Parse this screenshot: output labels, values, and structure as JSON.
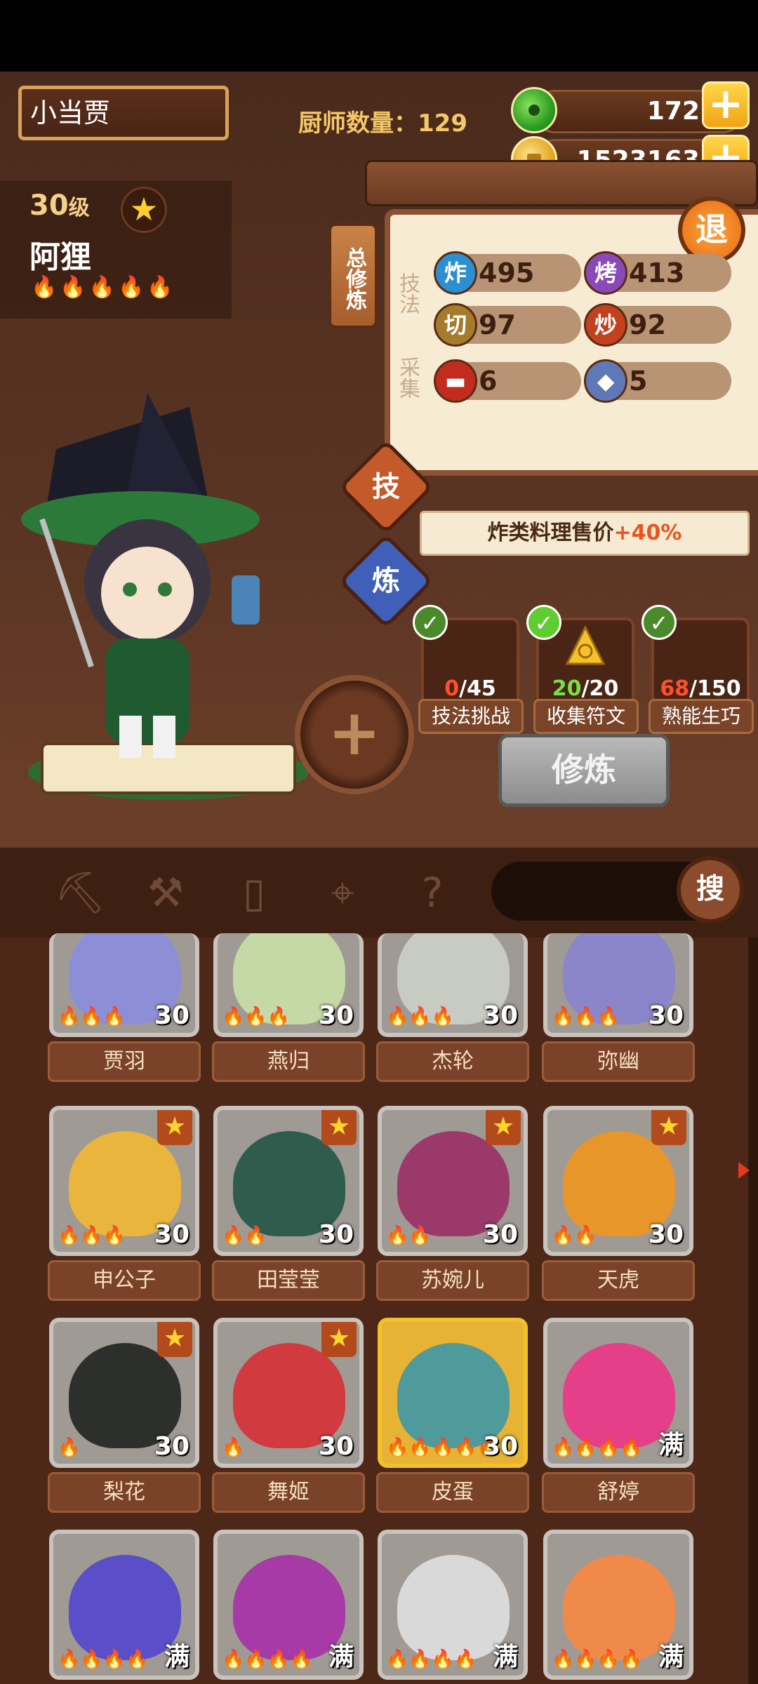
{
  "header": {
    "player_name": "小当贾",
    "chef_count_label": "厨师数量：129",
    "jade_amount": "172",
    "coin_amount": "1523163"
  },
  "chef": {
    "level_number": "30",
    "level_suffix": "级",
    "name": "阿狸",
    "flames": "🔥🔥🔥🔥🔥"
  },
  "panel": {
    "tag_label": "总修炼",
    "skill_label": "技法",
    "gather_label": "采集",
    "exit_label": "退",
    "skills": [
      {
        "icon": "炸",
        "value": "495",
        "color": "#2b8fd1"
      },
      {
        "icon": "烤",
        "value": "413",
        "color": "#8a49b8"
      },
      {
        "icon": "切",
        "value": "97",
        "color": "#a57b2c"
      },
      {
        "icon": "炒",
        "value": "92",
        "color": "#c2421f"
      }
    ],
    "gather": [
      {
        "icon": "meat-icon",
        "value": "6",
        "color": "#c22c1f"
      },
      {
        "icon": "fish-icon",
        "value": "5",
        "color": "#5f79b8"
      }
    ],
    "tab_skill": "技",
    "tab_train": "炼",
    "bonus_prefix": "炸类料理售价",
    "bonus_value": "+40%",
    "tasks": [
      {
        "current": "0",
        "total": "/45",
        "label": "技法挑战",
        "current_color": "#ff4f2e"
      },
      {
        "current": "20",
        "total": "/20",
        "label": "收集符文",
        "current_color": "#77e04a"
      },
      {
        "current": "68",
        "total": "/150",
        "label": "熟能生巧",
        "current_color": "#ff4f2e"
      }
    ],
    "train_button": "修炼",
    "search_button": "搜"
  },
  "chefs": [
    {
      "name": "贾羽",
      "level": "30",
      "fires": "🔥🔥🔥",
      "star": false,
      "color": "#8d8fd6",
      "gold": false
    },
    {
      "name": "燕归",
      "level": "30",
      "fires": "🔥🔥🔥",
      "star": false,
      "color": "#c4d9a5",
      "gold": false
    },
    {
      "name": "杰轮",
      "level": "30",
      "fires": "🔥🔥🔥",
      "star": false,
      "color": "#c8cbc2",
      "gold": false
    },
    {
      "name": "弥幽",
      "level": "30",
      "fires": "🔥🔥🔥",
      "star": false,
      "color": "#8b86c9",
      "gold": false
    },
    {
      "name": "申公子",
      "level": "30",
      "fires": "🔥🔥🔥",
      "star": true,
      "color": "#e9b53d",
      "gold": false
    },
    {
      "name": "田莹莹",
      "level": "30",
      "fires": "🔥🔥",
      "star": true,
      "color": "#2f5c4c",
      "gold": false
    },
    {
      "name": "苏婉儿",
      "level": "30",
      "fires": "🔥🔥",
      "star": true,
      "color": "#9b3a6a",
      "gold": false
    },
    {
      "name": "天虎",
      "level": "30",
      "fires": "🔥🔥",
      "star": true,
      "color": "#e7962a",
      "gold": false
    },
    {
      "name": "梨花",
      "level": "30",
      "fires": "🔥",
      "star": true,
      "color": "#2c2f2b",
      "gold": false
    },
    {
      "name": "舞姬",
      "level": "30",
      "fires": "🔥",
      "star": true,
      "color": "#d13b40",
      "gold": false
    },
    {
      "name": "皮蛋",
      "level": "30",
      "fires": "🔥🔥🔥🔥🔥",
      "star": false,
      "color": "#4f9a9a",
      "gold": true
    },
    {
      "name": "舒婷",
      "level": "满",
      "fires": "🔥🔥🔥🔥",
      "star": false,
      "color": "#e53f8a",
      "gold": false
    },
    {
      "name": "",
      "level": "满",
      "fires": "🔥🔥🔥🔥",
      "star": false,
      "color": "#5a4fc8",
      "gold": false
    },
    {
      "name": "",
      "level": "满",
      "fires": "🔥🔥🔥🔥",
      "star": false,
      "color": "#a63aa6",
      "gold": false
    },
    {
      "name": "",
      "level": "满",
      "fires": "🔥🔥🔥🔥",
      "star": false,
      "color": "#d9d9d9",
      "gold": false
    },
    {
      "name": "",
      "level": "满",
      "fires": "🔥🔥🔥🔥",
      "star": false,
      "color": "#f08a4a",
      "gold": false
    }
  ]
}
